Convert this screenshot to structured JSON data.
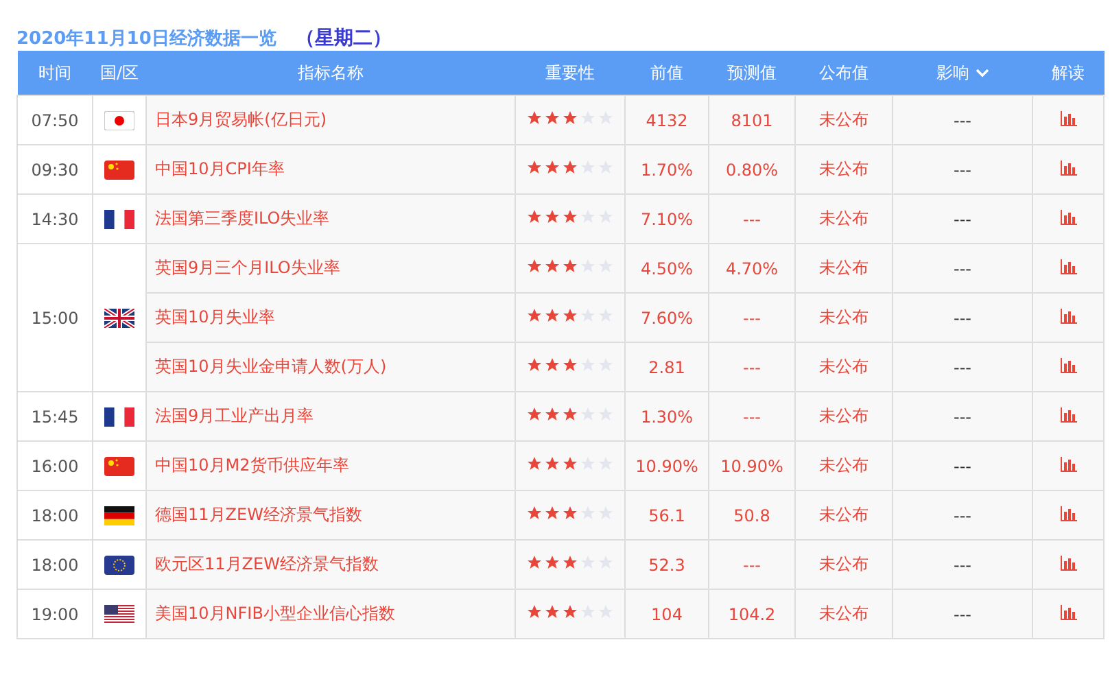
{
  "title": "2020年11月10日经济数据一览",
  "weekday": "（星期二）",
  "columns": [
    {
      "label": "时间"
    },
    {
      "label": "国/区"
    },
    {
      "label": "指标名称"
    },
    {
      "label": "重要性"
    },
    {
      "label": "前值"
    },
    {
      "label": "预测值"
    },
    {
      "label": "公布值"
    },
    {
      "label": "影响",
      "dropdown": true
    },
    {
      "label": "解读"
    }
  ],
  "events": [
    {
      "time": "07:50",
      "kind": "jp",
      "items": [
        {
          "name": "日本9月贸易帐(亿日元)",
          "stars": 3,
          "previous": "4132",
          "forecast": "8101",
          "actual": "未公布",
          "impact": "---"
        }
      ]
    },
    {
      "time": "09:30",
      "kind": "cn",
      "items": [
        {
          "name": "中国10月CPI年率",
          "stars": 3,
          "previous": "1.70%",
          "forecast": "0.80%",
          "actual": "未公布",
          "impact": "---"
        }
      ]
    },
    {
      "time": "14:30",
      "kind": "fr",
      "items": [
        {
          "name": "法国第三季度ILO失业率",
          "stars": 3,
          "previous": "7.10%",
          "forecast": "---",
          "actual": "未公布",
          "impact": "---"
        }
      ]
    },
    {
      "time": "15:00",
      "kind": "gb",
      "items": [
        {
          "name": "英国9月三个月ILO失业率",
          "stars": 3,
          "previous": "4.50%",
          "forecast": "4.70%",
          "actual": "未公布",
          "impact": "---"
        },
        {
          "name": "英国10月失业率",
          "stars": 3,
          "previous": "7.60%",
          "forecast": "---",
          "actual": "未公布",
          "impact": "---"
        },
        {
          "name": "英国10月失业金申请人数(万人)",
          "stars": 3,
          "previous": "2.81",
          "forecast": "---",
          "actual": "未公布",
          "impact": "---"
        }
      ]
    },
    {
      "time": "15:45",
      "kind": "fr",
      "items": [
        {
          "name": "法国9月工业产出月率",
          "stars": 3,
          "previous": "1.30%",
          "forecast": "---",
          "actual": "未公布",
          "impact": "---"
        }
      ]
    },
    {
      "time": "16:00",
      "kind": "cn",
      "items": [
        {
          "name": "中国10月M2货币供应年率",
          "stars": 3,
          "previous": "10.90%",
          "forecast": "10.90%",
          "actual": "未公布",
          "impact": "---"
        }
      ]
    },
    {
      "time": "18:00",
      "kind": "de",
      "items": [
        {
          "name": "德国11月ZEW经济景气指数",
          "stars": 3,
          "previous": "56.1",
          "forecast": "50.8",
          "actual": "未公布",
          "impact": "---"
        }
      ]
    },
    {
      "time": "18:00",
      "kind": "eu",
      "items": [
        {
          "name": "欧元区11月ZEW经济景气指数",
          "stars": 3,
          "previous": "52.3",
          "forecast": "---",
          "actual": "未公布",
          "impact": "---"
        }
      ]
    },
    {
      "time": "19:00",
      "kind": "us",
      "items": [
        {
          "name": "美国10月NFIB小型企业信心指数",
          "stars": 3,
          "previous": "104",
          "forecast": "104.2",
          "actual": "未公布",
          "impact": "---"
        }
      ]
    }
  ]
}
